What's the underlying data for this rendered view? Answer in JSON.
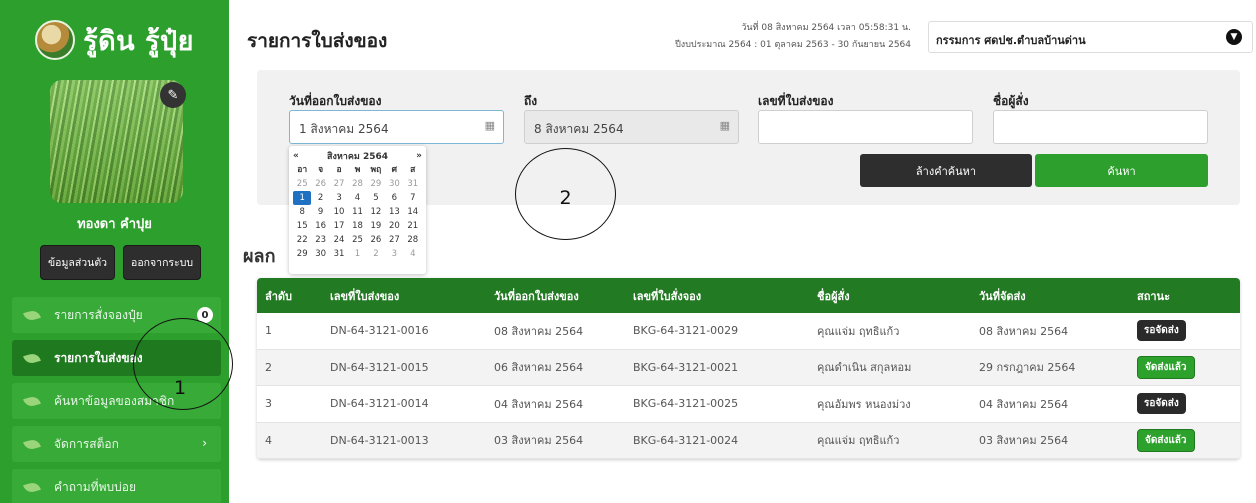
{
  "brand": {
    "logo_icon": "rice-logo-icon",
    "name": "รู้ดิน รู้ปุ๋ย"
  },
  "profile": {
    "name": "ทองดา คำปุย",
    "edit_icon": "pencil-icon",
    "buttons": [
      "ข้อมูลส่วนตัว",
      "ออกจากระบบ"
    ]
  },
  "sidebar": {
    "items": [
      {
        "label": "รายการสั่งจองปุ๋ย",
        "badge": "0",
        "active": false
      },
      {
        "label": "รายการใบส่งของ",
        "active": true
      },
      {
        "label": "ค้นหาข้อมูลของสมาชิก",
        "active": false
      },
      {
        "label": "จัดการสต็อก",
        "chevron": "›",
        "active": false
      },
      {
        "label": "คำถามที่พบบ่อย",
        "active": false
      }
    ]
  },
  "header": {
    "title": "รายการใบส่งของ",
    "datetime": "วันที่ 08 สิงหาคม 2564 เวลา 05:58:31 น.",
    "fiscal_year": "ปีงบประมาณ 2564 : 01 ตุลาคม 2563 - 30 กันยายน 2564",
    "user": "กรรมการ ศดปช.ตำบลบ้านด่าน"
  },
  "search": {
    "from_label": "วันที่ออกใบส่งของ",
    "from_value": "1 สิงหาคม 2564",
    "to_label": "ถึง",
    "to_value": "8 สิงหาคม 2564",
    "doc_label": "เลขที่ใบส่งของ",
    "doc_value": "",
    "buyer_label": "ชื่อผู้สั่ง",
    "buyer_value": "",
    "clear_button": "ล้างคำค้นหา",
    "search_button": "ค้นหา"
  },
  "datepicker": {
    "prev": "«",
    "month": "สิงหาคม 2564",
    "next": "»",
    "weekdays": [
      "อา",
      "จ",
      "อ",
      "พ",
      "พฤ",
      "ศ",
      "ส"
    ],
    "weeks": [
      [
        "25",
        "26",
        "27",
        "28",
        "29",
        "30",
        "31"
      ],
      [
        "1",
        "2",
        "3",
        "4",
        "5",
        "6",
        "7"
      ],
      [
        "8",
        "9",
        "10",
        "11",
        "12",
        "13",
        "14"
      ],
      [
        "15",
        "16",
        "17",
        "18",
        "19",
        "20",
        "21"
      ],
      [
        "22",
        "23",
        "24",
        "25",
        "26",
        "27",
        "28"
      ],
      [
        "29",
        "30",
        "31",
        "1",
        "2",
        "3",
        "4"
      ]
    ],
    "selected": "1"
  },
  "results": {
    "title": "ผลก",
    "columns": [
      "ลำดับ",
      "เลขที่ใบส่งของ",
      "วันที่ออกใบส่งของ",
      "เลขที่ใบสั่งจอง",
      "ชื่อผู้สั่ง",
      "วันที่จัดส่ง",
      "สถานะ"
    ],
    "rows": [
      [
        "1",
        "DN-64-3121-0016",
        "08 สิงหาคม 2564",
        "BKG-64-3121-0029",
        "คุณแจ่ม ฤทธิแก้ว",
        "08 สิงหาคม 2564",
        "รอจัดส่ง"
      ],
      [
        "2",
        "DN-64-3121-0015",
        "06 สิงหาคม 2564",
        "BKG-64-3121-0021",
        "คุณดำเนิน สกุลหอม",
        "29 กรกฎาคม 2564",
        "จัดส่งแล้ว"
      ],
      [
        "3",
        "DN-64-3121-0014",
        "04 สิงหาคม 2564",
        "BKG-64-3121-0025",
        "คุณอัมพร หนองม่วง",
        "04 สิงหาคม 2564",
        "รอจัดส่ง"
      ],
      [
        "4",
        "DN-64-3121-0013",
        "03 สิงหาคม 2564",
        "BKG-64-3121-0024",
        "คุณแจ่ม ฤทธิแก้ว",
        "03 สิงหาคม 2564",
        "จัดส่งแล้ว"
      ]
    ]
  },
  "annotations": [
    "1",
    "2"
  ],
  "colors": {
    "primary": "#2d9f2d",
    "dark_green": "#227a22",
    "dark": "#2e2e2e"
  }
}
